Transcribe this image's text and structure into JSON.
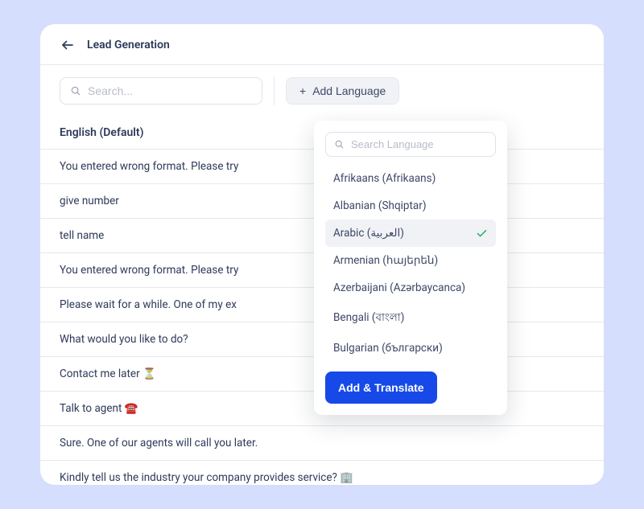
{
  "header": {
    "title": "Lead Generation"
  },
  "toolbar": {
    "search_placeholder": "Search...",
    "add_language_label": "Add Language"
  },
  "language_header": "English (Default)",
  "rows": [
    "You entered wrong format. Please try",
    "give number",
    "tell name",
    "You entered wrong format. Please try",
    "Please wait for a while. One of my ex",
    "What would you like to do?",
    "Contact me later ⏳",
    "Talk to agent ☎️",
    "Sure. One of our agents will call you later.",
    "Kindly tell us the industry your company provides service? 🏢"
  ],
  "dropdown": {
    "search_placeholder": "Search Language",
    "items": [
      {
        "label": "Afrikaans (Afrikaans)",
        "selected": false
      },
      {
        "label": "Albanian (Shqiptar)",
        "selected": false
      },
      {
        "label": "Arabic (العربية)",
        "selected": true
      },
      {
        "label": "Armenian (հայերեն)",
        "selected": false
      },
      {
        "label": "Azerbaijani (Azərbaycanca)",
        "selected": false
      },
      {
        "label": "Bengali (বাংলা)",
        "selected": false
      },
      {
        "label": "Bulgarian (български)",
        "selected": false
      }
    ],
    "action_label": "Add & Translate"
  }
}
